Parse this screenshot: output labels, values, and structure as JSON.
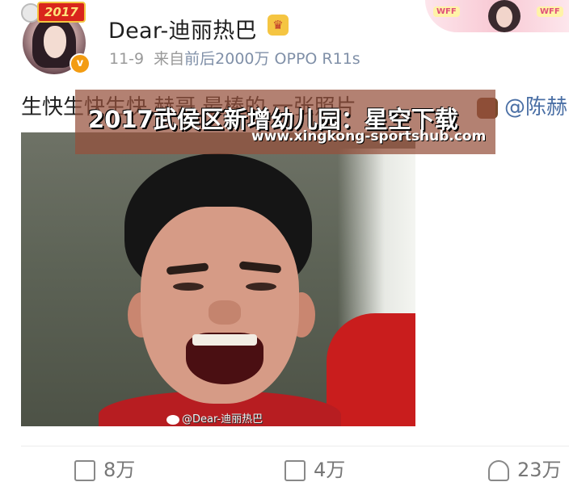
{
  "header": {
    "badge_year": "2017",
    "username": "Dear-迪丽热巴",
    "verified_mark": "v",
    "crown_icon": "crown-icon",
    "date": "11-9",
    "source_prefix": "来自",
    "source": "前后2000万 OPPO R11s"
  },
  "decoration": {
    "tag_left": "WFF",
    "tag_right": "WFF"
  },
  "post": {
    "text": "生快生快生快 赫哥 最棒的 一张照片",
    "mention": "@陈赫"
  },
  "banner": {
    "title": "2017武侯区新增幼儿园：星空下载",
    "url": "www.xingkong-sportshub.com"
  },
  "photo": {
    "watermark": "@Dear-迪丽热巴"
  },
  "actions": {
    "share": "8万",
    "comment": "4万",
    "like": "23万"
  }
}
